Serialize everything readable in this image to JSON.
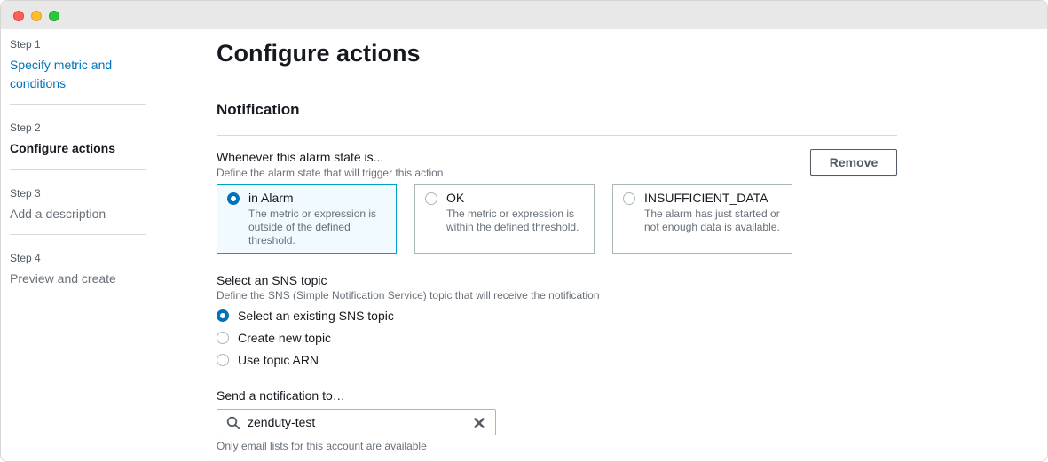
{
  "sidebar": {
    "steps": [
      {
        "number": "Step 1",
        "title": "Specify metric and conditions"
      },
      {
        "number": "Step 2",
        "title": "Configure actions"
      },
      {
        "number": "Step 3",
        "title": "Add a description"
      },
      {
        "number": "Step 4",
        "title": "Preview and create"
      }
    ]
  },
  "main": {
    "page_title": "Configure actions",
    "section_title": "Notification",
    "alarm_state": {
      "label": "Whenever this alarm state is...",
      "description": "Define the alarm state that will trigger this action",
      "remove_label": "Remove",
      "options": [
        {
          "label": "in Alarm",
          "description": "The metric or expression is outside of the defined threshold.",
          "selected": true
        },
        {
          "label": "OK",
          "description": "The metric or expression is within the defined threshold.",
          "selected": false
        },
        {
          "label": "INSUFFICIENT_DATA",
          "description": "The alarm has just started or not enough data is available.",
          "selected": false
        }
      ]
    },
    "sns_topic": {
      "label": "Select an SNS topic",
      "description": "Define the SNS (Simple Notification Service) topic that will receive the notification",
      "options": [
        {
          "label": "Select an existing SNS topic",
          "selected": true
        },
        {
          "label": "Create new topic",
          "selected": false
        },
        {
          "label": "Use topic ARN",
          "selected": false
        }
      ]
    },
    "send_to": {
      "label": "Send a notification to…",
      "value": "zenduty-test",
      "hint": "Only email lists for this account are available"
    }
  },
  "colors": {
    "accent": "#0073bb",
    "selected_border": "#00a1c9",
    "selected_bg": "#f1faff"
  }
}
